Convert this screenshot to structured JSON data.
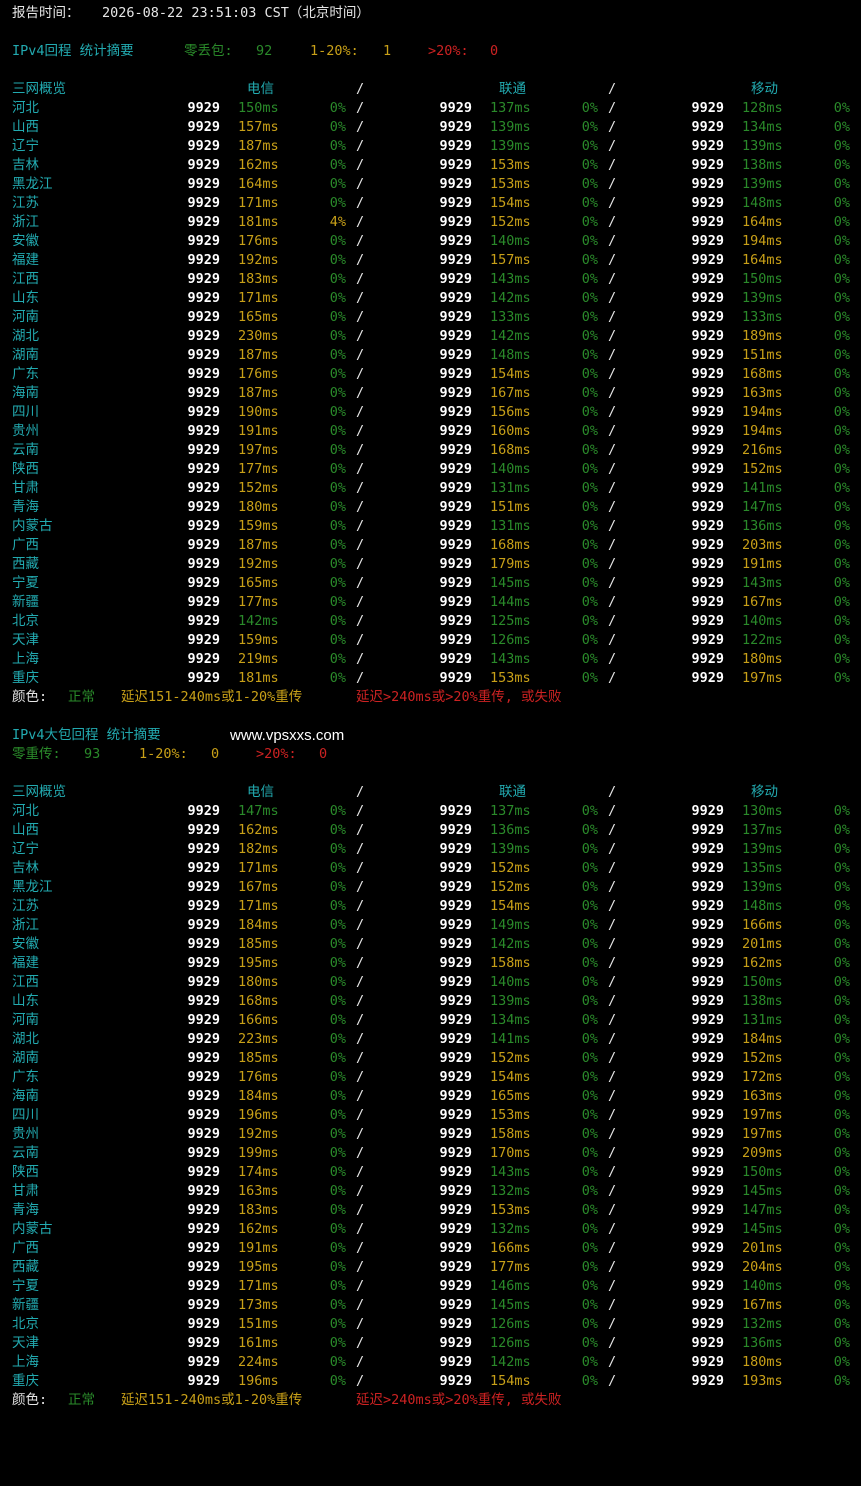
{
  "report": {
    "label": "报告时间：",
    "time": "2026-08-22 23:51:03 CST（北京时间）"
  },
  "colors": {
    "background": "#000000",
    "ok": "#2a8a2a",
    "warn": "#c8a018",
    "bad": "#cc2222",
    "title": "#22aab0"
  },
  "section1": {
    "title": "IPv4回程 统计摘要",
    "summary": [
      {
        "label": "零丢包:",
        "value": "92"
      },
      {
        "label": "1-20%:",
        "value": "1"
      },
      {
        "label": ">20%:",
        "value": "0"
      }
    ],
    "header": {
      "col0": "三网概览",
      "carriers": [
        "电信",
        "联通",
        "移动"
      ],
      "sep": "/"
    },
    "rows": [
      {
        "name": "河北",
        "ct": [
          "9929",
          "150ms",
          "0%"
        ],
        "cu": [
          "9929",
          "137ms",
          "0%"
        ],
        "cm": [
          "9929",
          "128ms",
          "0%"
        ]
      },
      {
        "name": "山西",
        "ct": [
          "9929",
          "157ms",
          "0%"
        ],
        "cu": [
          "9929",
          "139ms",
          "0%"
        ],
        "cm": [
          "9929",
          "134ms",
          "0%"
        ]
      },
      {
        "name": "辽宁",
        "ct": [
          "9929",
          "187ms",
          "0%"
        ],
        "cu": [
          "9929",
          "139ms",
          "0%"
        ],
        "cm": [
          "9929",
          "139ms",
          "0%"
        ]
      },
      {
        "name": "吉林",
        "ct": [
          "9929",
          "162ms",
          "0%"
        ],
        "cu": [
          "9929",
          "153ms",
          "0%"
        ],
        "cm": [
          "9929",
          "138ms",
          "0%"
        ]
      },
      {
        "name": "黑龙江",
        "ct": [
          "9929",
          "164ms",
          "0%"
        ],
        "cu": [
          "9929",
          "153ms",
          "0%"
        ],
        "cm": [
          "9929",
          "139ms",
          "0%"
        ]
      },
      {
        "name": "江苏",
        "ct": [
          "9929",
          "171ms",
          "0%"
        ],
        "cu": [
          "9929",
          "154ms",
          "0%"
        ],
        "cm": [
          "9929",
          "148ms",
          "0%"
        ]
      },
      {
        "name": "浙江",
        "ct": [
          "9929",
          "181ms",
          "4%"
        ],
        "cu": [
          "9929",
          "152ms",
          "0%"
        ],
        "cm": [
          "9929",
          "164ms",
          "0%"
        ]
      },
      {
        "name": "安徽",
        "ct": [
          "9929",
          "176ms",
          "0%"
        ],
        "cu": [
          "9929",
          "140ms",
          "0%"
        ],
        "cm": [
          "9929",
          "194ms",
          "0%"
        ]
      },
      {
        "name": "福建",
        "ct": [
          "9929",
          "192ms",
          "0%"
        ],
        "cu": [
          "9929",
          "157ms",
          "0%"
        ],
        "cm": [
          "9929",
          "164ms",
          "0%"
        ]
      },
      {
        "name": "江西",
        "ct": [
          "9929",
          "183ms",
          "0%"
        ],
        "cu": [
          "9929",
          "143ms",
          "0%"
        ],
        "cm": [
          "9929",
          "150ms",
          "0%"
        ]
      },
      {
        "name": "山东",
        "ct": [
          "9929",
          "171ms",
          "0%"
        ],
        "cu": [
          "9929",
          "142ms",
          "0%"
        ],
        "cm": [
          "9929",
          "139ms",
          "0%"
        ]
      },
      {
        "name": "河南",
        "ct": [
          "9929",
          "165ms",
          "0%"
        ],
        "cu": [
          "9929",
          "133ms",
          "0%"
        ],
        "cm": [
          "9929",
          "133ms",
          "0%"
        ]
      },
      {
        "name": "湖北",
        "ct": [
          "9929",
          "230ms",
          "0%"
        ],
        "cu": [
          "9929",
          "142ms",
          "0%"
        ],
        "cm": [
          "9929",
          "189ms",
          "0%"
        ]
      },
      {
        "name": "湖南",
        "ct": [
          "9929",
          "187ms",
          "0%"
        ],
        "cu": [
          "9929",
          "148ms",
          "0%"
        ],
        "cm": [
          "9929",
          "151ms",
          "0%"
        ]
      },
      {
        "name": "广东",
        "ct": [
          "9929",
          "176ms",
          "0%"
        ],
        "cu": [
          "9929",
          "154ms",
          "0%"
        ],
        "cm": [
          "9929",
          "168ms",
          "0%"
        ]
      },
      {
        "name": "海南",
        "ct": [
          "9929",
          "187ms",
          "0%"
        ],
        "cu": [
          "9929",
          "167ms",
          "0%"
        ],
        "cm": [
          "9929",
          "163ms",
          "0%"
        ]
      },
      {
        "name": "四川",
        "ct": [
          "9929",
          "190ms",
          "0%"
        ],
        "cu": [
          "9929",
          "156ms",
          "0%"
        ],
        "cm": [
          "9929",
          "194ms",
          "0%"
        ]
      },
      {
        "name": "贵州",
        "ct": [
          "9929",
          "191ms",
          "0%"
        ],
        "cu": [
          "9929",
          "160ms",
          "0%"
        ],
        "cm": [
          "9929",
          "194ms",
          "0%"
        ]
      },
      {
        "name": "云南",
        "ct": [
          "9929",
          "197ms",
          "0%"
        ],
        "cu": [
          "9929",
          "168ms",
          "0%"
        ],
        "cm": [
          "9929",
          "216ms",
          "0%"
        ]
      },
      {
        "name": "陕西",
        "ct": [
          "9929",
          "177ms",
          "0%"
        ],
        "cu": [
          "9929",
          "140ms",
          "0%"
        ],
        "cm": [
          "9929",
          "152ms",
          "0%"
        ]
      },
      {
        "name": "甘肃",
        "ct": [
          "9929",
          "152ms",
          "0%"
        ],
        "cu": [
          "9929",
          "131ms",
          "0%"
        ],
        "cm": [
          "9929",
          "141ms",
          "0%"
        ]
      },
      {
        "name": "青海",
        "ct": [
          "9929",
          "180ms",
          "0%"
        ],
        "cu": [
          "9929",
          "151ms",
          "0%"
        ],
        "cm": [
          "9929",
          "147ms",
          "0%"
        ]
      },
      {
        "name": "内蒙古",
        "ct": [
          "9929",
          "159ms",
          "0%"
        ],
        "cu": [
          "9929",
          "131ms",
          "0%"
        ],
        "cm": [
          "9929",
          "136ms",
          "0%"
        ]
      },
      {
        "name": "广西",
        "ct": [
          "9929",
          "187ms",
          "0%"
        ],
        "cu": [
          "9929",
          "168ms",
          "0%"
        ],
        "cm": [
          "9929",
          "203ms",
          "0%"
        ]
      },
      {
        "name": "西藏",
        "ct": [
          "9929",
          "192ms",
          "0%"
        ],
        "cu": [
          "9929",
          "179ms",
          "0%"
        ],
        "cm": [
          "9929",
          "191ms",
          "0%"
        ]
      },
      {
        "name": "宁夏",
        "ct": [
          "9929",
          "165ms",
          "0%"
        ],
        "cu": [
          "9929",
          "145ms",
          "0%"
        ],
        "cm": [
          "9929",
          "143ms",
          "0%"
        ]
      },
      {
        "name": "新疆",
        "ct": [
          "9929",
          "177ms",
          "0%"
        ],
        "cu": [
          "9929",
          "144ms",
          "0%"
        ],
        "cm": [
          "9929",
          "167ms",
          "0%"
        ]
      },
      {
        "name": "北京",
        "ct": [
          "9929",
          "142ms",
          "0%"
        ],
        "cu": [
          "9929",
          "125ms",
          "0%"
        ],
        "cm": [
          "9929",
          "140ms",
          "0%"
        ]
      },
      {
        "name": "天津",
        "ct": [
          "9929",
          "159ms",
          "0%"
        ],
        "cu": [
          "9929",
          "126ms",
          "0%"
        ],
        "cm": [
          "9929",
          "122ms",
          "0%"
        ]
      },
      {
        "name": "上海",
        "ct": [
          "9929",
          "219ms",
          "0%"
        ],
        "cu": [
          "9929",
          "143ms",
          "0%"
        ],
        "cm": [
          "9929",
          "180ms",
          "0%"
        ]
      },
      {
        "name": "重庆",
        "ct": [
          "9929",
          "181ms",
          "0%"
        ],
        "cu": [
          "9929",
          "153ms",
          "0%"
        ],
        "cm": [
          "9929",
          "197ms",
          "0%"
        ]
      }
    ]
  },
  "legend": {
    "label": "颜色:",
    "ok": "正常",
    "warn": "延迟151-240ms或1-20%重传",
    "bad": "延迟>240ms或>20%重传, 或失败"
  },
  "section2": {
    "title": "IPv4大包回程 统计摘要",
    "watermark": "www.vpsxxs.com",
    "summary": [
      {
        "label": "零重传:",
        "value": "93"
      },
      {
        "label": "1-20%:",
        "value": "0"
      },
      {
        "label": ">20%:",
        "value": "0"
      }
    ],
    "header": {
      "col0": "三网概览",
      "carriers": [
        "电信",
        "联通",
        "移动"
      ],
      "sep": "/"
    },
    "rows": [
      {
        "name": "河北",
        "ct": [
          "9929",
          "147ms",
          "0%"
        ],
        "cu": [
          "9929",
          "137ms",
          "0%"
        ],
        "cm": [
          "9929",
          "130ms",
          "0%"
        ]
      },
      {
        "name": "山西",
        "ct": [
          "9929",
          "162ms",
          "0%"
        ],
        "cu": [
          "9929",
          "136ms",
          "0%"
        ],
        "cm": [
          "9929",
          "137ms",
          "0%"
        ]
      },
      {
        "name": "辽宁",
        "ct": [
          "9929",
          "182ms",
          "0%"
        ],
        "cu": [
          "9929",
          "139ms",
          "0%"
        ],
        "cm": [
          "9929",
          "139ms",
          "0%"
        ]
      },
      {
        "name": "吉林",
        "ct": [
          "9929",
          "171ms",
          "0%"
        ],
        "cu": [
          "9929",
          "152ms",
          "0%"
        ],
        "cm": [
          "9929",
          "135ms",
          "0%"
        ]
      },
      {
        "name": "黑龙江",
        "ct": [
          "9929",
          "167ms",
          "0%"
        ],
        "cu": [
          "9929",
          "152ms",
          "0%"
        ],
        "cm": [
          "9929",
          "139ms",
          "0%"
        ]
      },
      {
        "name": "江苏",
        "ct": [
          "9929",
          "171ms",
          "0%"
        ],
        "cu": [
          "9929",
          "154ms",
          "0%"
        ],
        "cm": [
          "9929",
          "148ms",
          "0%"
        ]
      },
      {
        "name": "浙江",
        "ct": [
          "9929",
          "184ms",
          "0%"
        ],
        "cu": [
          "9929",
          "149ms",
          "0%"
        ],
        "cm": [
          "9929",
          "166ms",
          "0%"
        ]
      },
      {
        "name": "安徽",
        "ct": [
          "9929",
          "185ms",
          "0%"
        ],
        "cu": [
          "9929",
          "142ms",
          "0%"
        ],
        "cm": [
          "9929",
          "201ms",
          "0%"
        ]
      },
      {
        "name": "福建",
        "ct": [
          "9929",
          "195ms",
          "0%"
        ],
        "cu": [
          "9929",
          "158ms",
          "0%"
        ],
        "cm": [
          "9929",
          "162ms",
          "0%"
        ]
      },
      {
        "name": "江西",
        "ct": [
          "9929",
          "180ms",
          "0%"
        ],
        "cu": [
          "9929",
          "140ms",
          "0%"
        ],
        "cm": [
          "9929",
          "150ms",
          "0%"
        ]
      },
      {
        "name": "山东",
        "ct": [
          "9929",
          "168ms",
          "0%"
        ],
        "cu": [
          "9929",
          "139ms",
          "0%"
        ],
        "cm": [
          "9929",
          "138ms",
          "0%"
        ]
      },
      {
        "name": "河南",
        "ct": [
          "9929",
          "166ms",
          "0%"
        ],
        "cu": [
          "9929",
          "134ms",
          "0%"
        ],
        "cm": [
          "9929",
          "131ms",
          "0%"
        ]
      },
      {
        "name": "湖北",
        "ct": [
          "9929",
          "223ms",
          "0%"
        ],
        "cu": [
          "9929",
          "141ms",
          "0%"
        ],
        "cm": [
          "9929",
          "184ms",
          "0%"
        ]
      },
      {
        "name": "湖南",
        "ct": [
          "9929",
          "185ms",
          "0%"
        ],
        "cu": [
          "9929",
          "152ms",
          "0%"
        ],
        "cm": [
          "9929",
          "152ms",
          "0%"
        ]
      },
      {
        "name": "广东",
        "ct": [
          "9929",
          "176ms",
          "0%"
        ],
        "cu": [
          "9929",
          "154ms",
          "0%"
        ],
        "cm": [
          "9929",
          "172ms",
          "0%"
        ]
      },
      {
        "name": "海南",
        "ct": [
          "9929",
          "184ms",
          "0%"
        ],
        "cu": [
          "9929",
          "165ms",
          "0%"
        ],
        "cm": [
          "9929",
          "163ms",
          "0%"
        ]
      },
      {
        "name": "四川",
        "ct": [
          "9929",
          "196ms",
          "0%"
        ],
        "cu": [
          "9929",
          "153ms",
          "0%"
        ],
        "cm": [
          "9929",
          "197ms",
          "0%"
        ]
      },
      {
        "name": "贵州",
        "ct": [
          "9929",
          "192ms",
          "0%"
        ],
        "cu": [
          "9929",
          "158ms",
          "0%"
        ],
        "cm": [
          "9929",
          "197ms",
          "0%"
        ]
      },
      {
        "name": "云南",
        "ct": [
          "9929",
          "199ms",
          "0%"
        ],
        "cu": [
          "9929",
          "170ms",
          "0%"
        ],
        "cm": [
          "9929",
          "209ms",
          "0%"
        ]
      },
      {
        "name": "陕西",
        "ct": [
          "9929",
          "174ms",
          "0%"
        ],
        "cu": [
          "9929",
          "143ms",
          "0%"
        ],
        "cm": [
          "9929",
          "150ms",
          "0%"
        ]
      },
      {
        "name": "甘肃",
        "ct": [
          "9929",
          "163ms",
          "0%"
        ],
        "cu": [
          "9929",
          "132ms",
          "0%"
        ],
        "cm": [
          "9929",
          "145ms",
          "0%"
        ]
      },
      {
        "name": "青海",
        "ct": [
          "9929",
          "183ms",
          "0%"
        ],
        "cu": [
          "9929",
          "153ms",
          "0%"
        ],
        "cm": [
          "9929",
          "147ms",
          "0%"
        ]
      },
      {
        "name": "内蒙古",
        "ct": [
          "9929",
          "162ms",
          "0%"
        ],
        "cu": [
          "9929",
          "132ms",
          "0%"
        ],
        "cm": [
          "9929",
          "145ms",
          "0%"
        ]
      },
      {
        "name": "广西",
        "ct": [
          "9929",
          "191ms",
          "0%"
        ],
        "cu": [
          "9929",
          "166ms",
          "0%"
        ],
        "cm": [
          "9929",
          "201ms",
          "0%"
        ]
      },
      {
        "name": "西藏",
        "ct": [
          "9929",
          "195ms",
          "0%"
        ],
        "cu": [
          "9929",
          "177ms",
          "0%"
        ],
        "cm": [
          "9929",
          "204ms",
          "0%"
        ]
      },
      {
        "name": "宁夏",
        "ct": [
          "9929",
          "171ms",
          "0%"
        ],
        "cu": [
          "9929",
          "146ms",
          "0%"
        ],
        "cm": [
          "9929",
          "140ms",
          "0%"
        ]
      },
      {
        "name": "新疆",
        "ct": [
          "9929",
          "173ms",
          "0%"
        ],
        "cu": [
          "9929",
          "145ms",
          "0%"
        ],
        "cm": [
          "9929",
          "167ms",
          "0%"
        ]
      },
      {
        "name": "北京",
        "ct": [
          "9929",
          "151ms",
          "0%"
        ],
        "cu": [
          "9929",
          "126ms",
          "0%"
        ],
        "cm": [
          "9929",
          "132ms",
          "0%"
        ]
      },
      {
        "name": "天津",
        "ct": [
          "9929",
          "161ms",
          "0%"
        ],
        "cu": [
          "9929",
          "126ms",
          "0%"
        ],
        "cm": [
          "9929",
          "136ms",
          "0%"
        ]
      },
      {
        "name": "上海",
        "ct": [
          "9929",
          "224ms",
          "0%"
        ],
        "cu": [
          "9929",
          "142ms",
          "0%"
        ],
        "cm": [
          "9929",
          "180ms",
          "0%"
        ]
      },
      {
        "name": "重庆",
        "ct": [
          "9929",
          "196ms",
          "0%"
        ],
        "cu": [
          "9929",
          "154ms",
          "0%"
        ],
        "cm": [
          "9929",
          "193ms",
          "0%"
        ]
      }
    ]
  }
}
